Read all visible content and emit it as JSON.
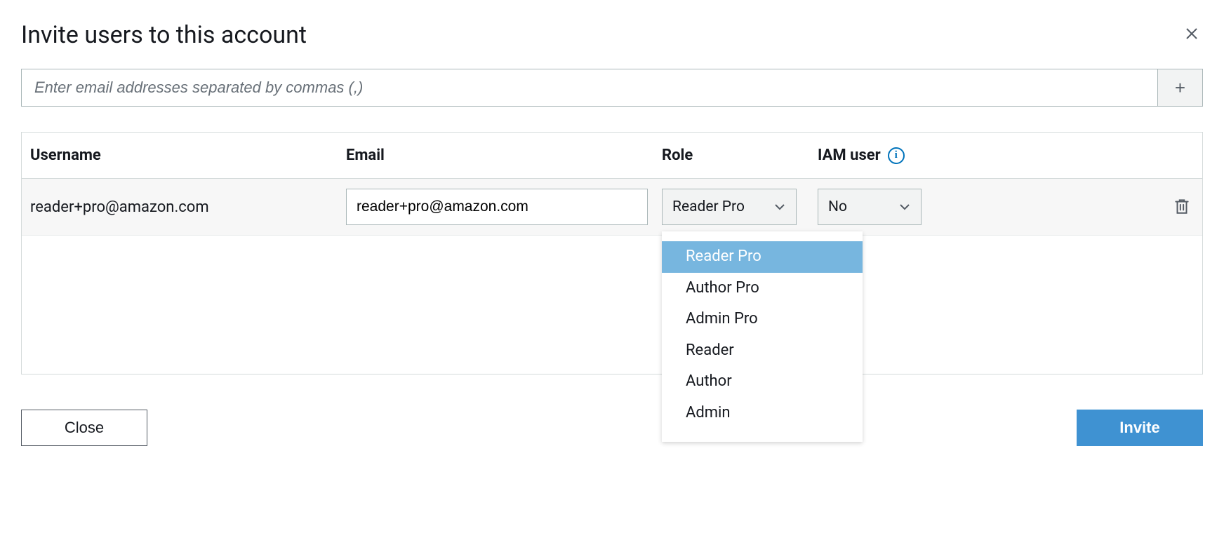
{
  "dialog": {
    "title": "Invite users to this account",
    "emailPlaceholder": "Enter email addresses separated by commas (,)"
  },
  "table": {
    "headers": {
      "username": "Username",
      "email": "Email",
      "role": "Role",
      "iam": "IAM user"
    }
  },
  "rows": [
    {
      "username": "reader+pro@amazon.com",
      "email": "reader+pro@amazon.com",
      "roleSelected": "Reader Pro",
      "iamSelected": "No"
    }
  ],
  "roleOptions": [
    {
      "label": "Reader Pro",
      "selected": true
    },
    {
      "label": "Author Pro",
      "selected": false
    },
    {
      "label": "Admin Pro",
      "selected": false
    },
    {
      "label": "Reader",
      "selected": false
    },
    {
      "label": "Author",
      "selected": false
    },
    {
      "label": "Admin",
      "selected": false
    }
  ],
  "footer": {
    "close": "Close",
    "invite": "Invite"
  },
  "icons": {
    "info": "i",
    "plus": "+"
  }
}
